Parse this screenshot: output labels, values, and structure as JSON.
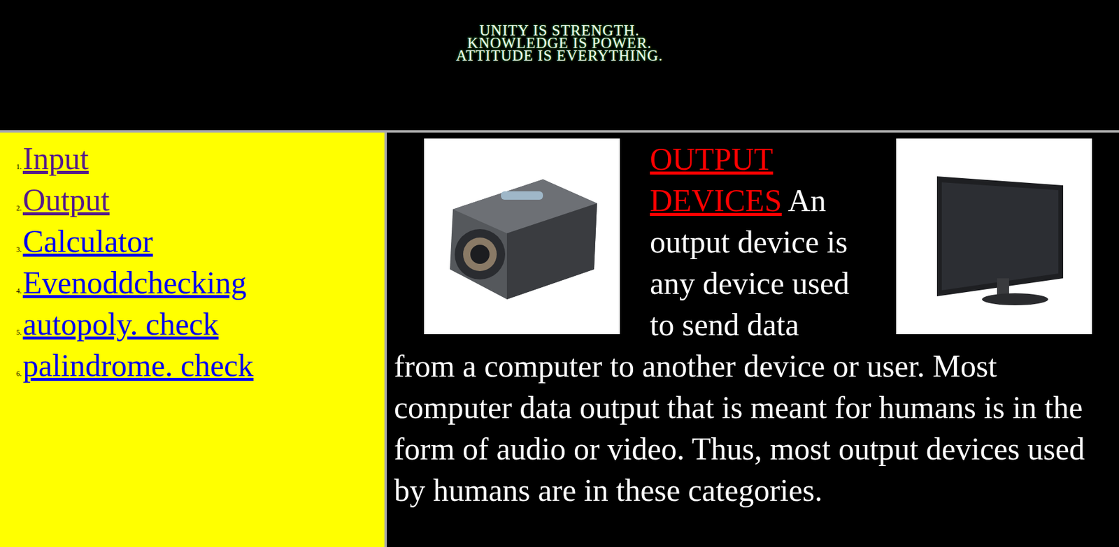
{
  "banner": {
    "lines": [
      "UNITY IS STRENGTH.",
      "KNOWLEDGE IS POWER.",
      "ATTITUDE IS EVERYTHING."
    ]
  },
  "sidebar": {
    "items": [
      {
        "marker": "1.",
        "label": "Input",
        "visited": true
      },
      {
        "marker": "2.",
        "label": "Output",
        "visited": true
      },
      {
        "marker": "3.",
        "label": "Calculator",
        "visited": false
      },
      {
        "marker": "4.",
        "label": "Evenoddchecking",
        "visited": false
      },
      {
        "marker": "5.",
        "label": "autopoly. check",
        "visited": false
      },
      {
        "marker": "6.",
        "label": "palindrome. check",
        "visited": false
      }
    ]
  },
  "content": {
    "heading": "OUTPUT DEVICES",
    "text": " An output device is any device used to send data from a computer to another device or user. Most computer data output that is meant for humans is in the form of audio or video. Thus, most output devices used by humans are in these categories."
  }
}
